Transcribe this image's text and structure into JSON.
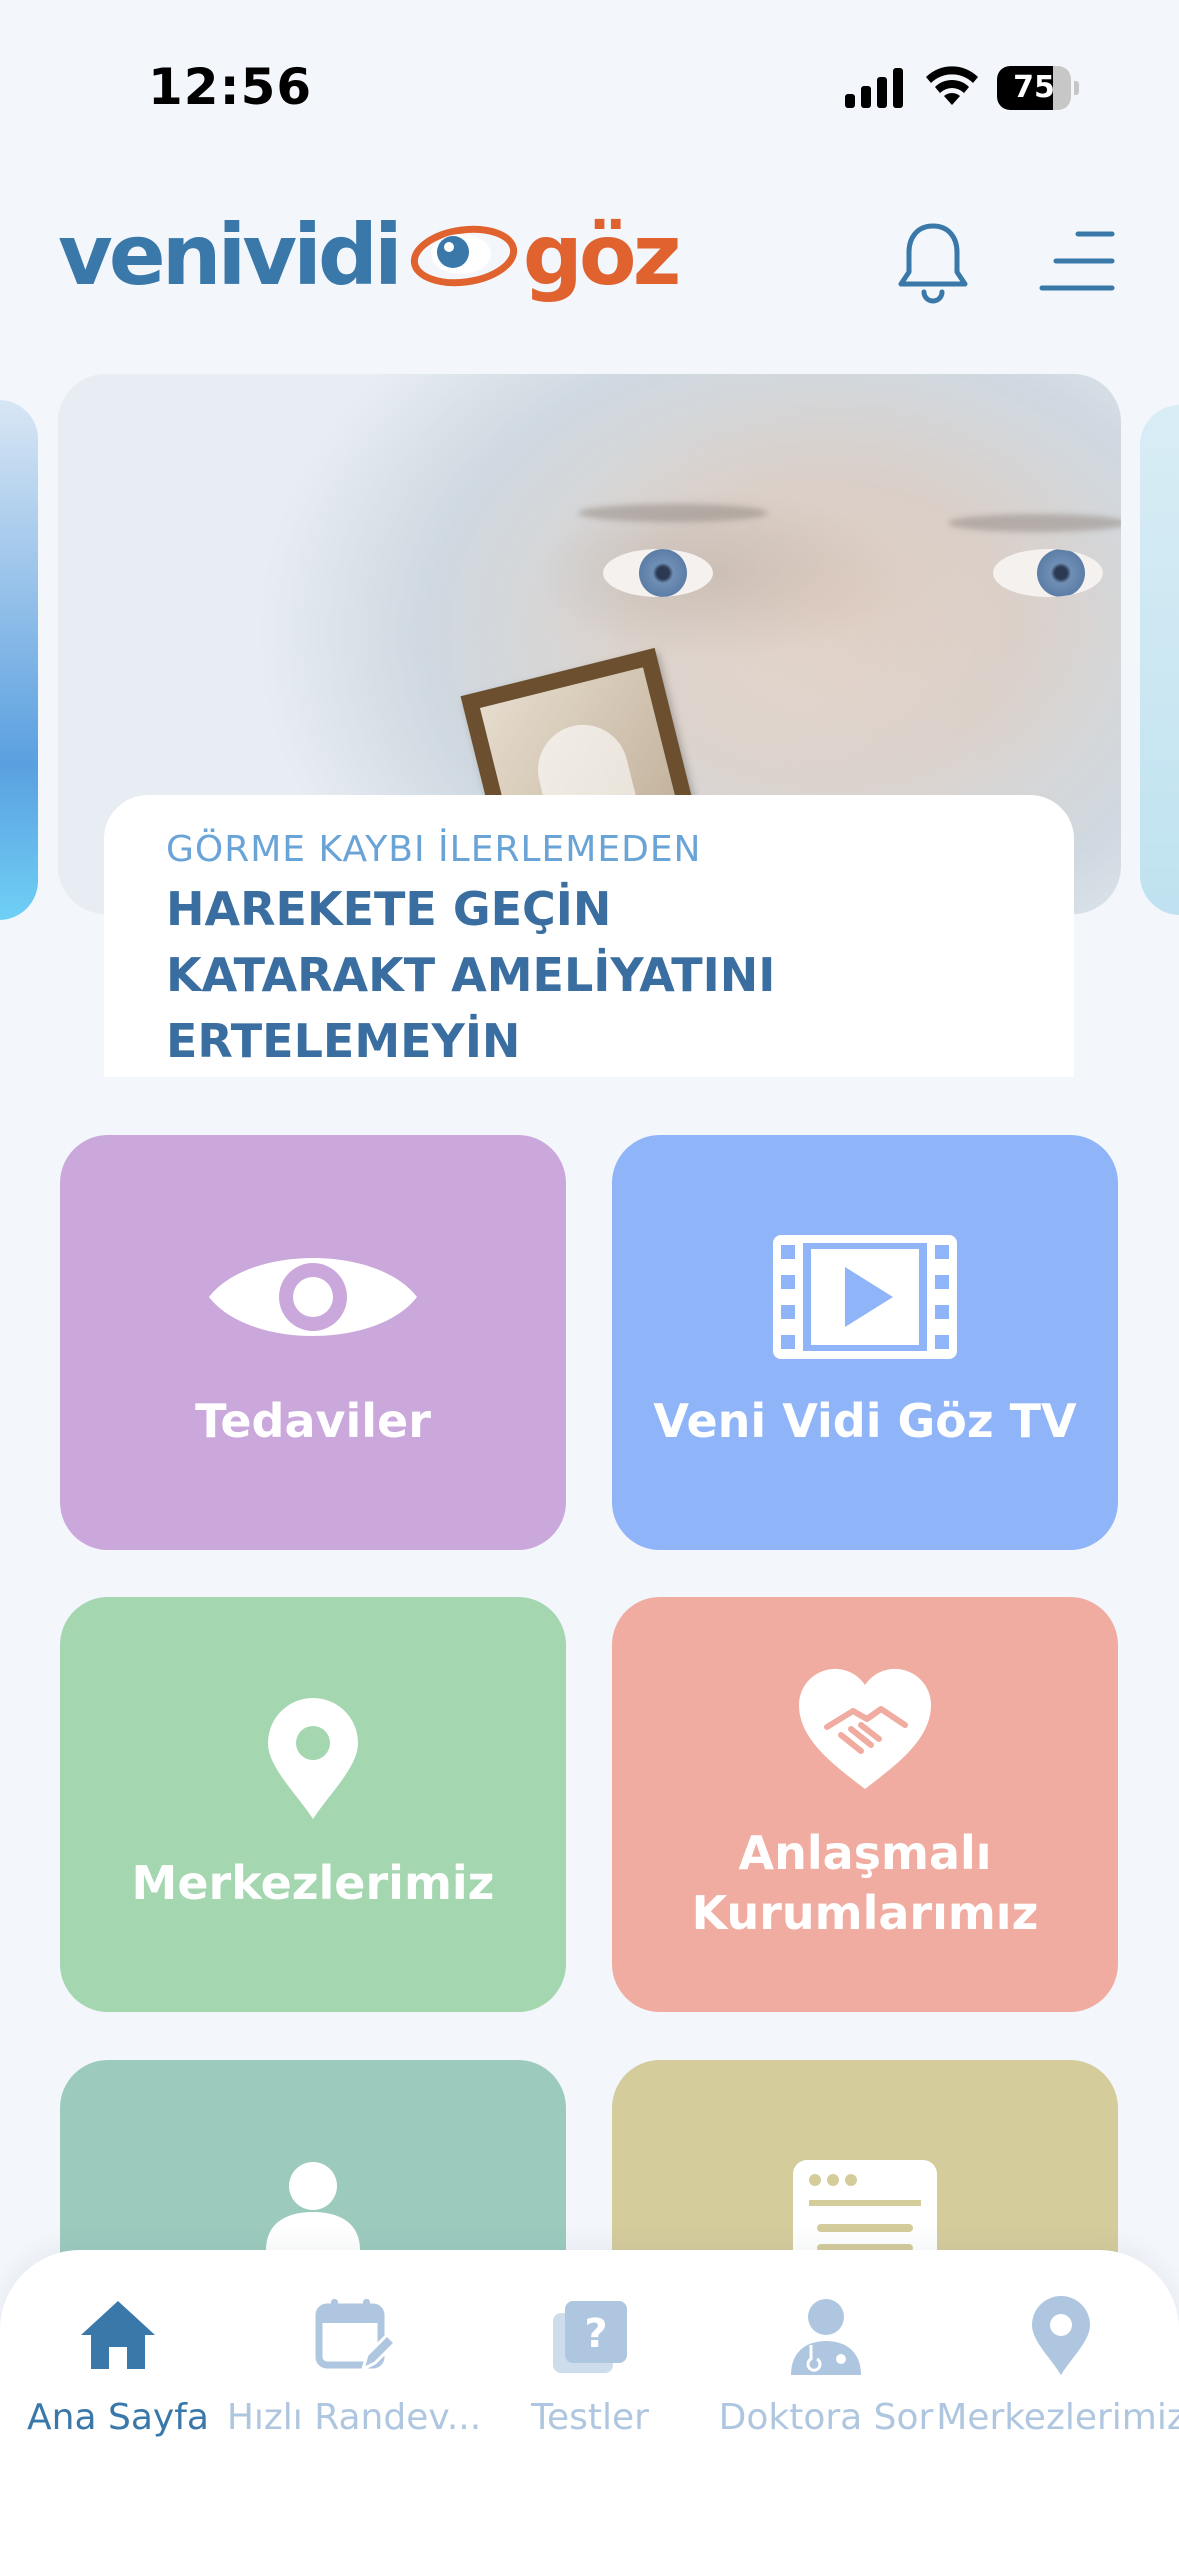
{
  "status_bar": {
    "time": "12:56",
    "battery_level": "75",
    "battery_percent": 75
  },
  "header": {
    "logo": {
      "part1": "venividi",
      "part2": "göz"
    },
    "icons": [
      "bell-icon",
      "menu-icon"
    ]
  },
  "banner": {
    "subtitle": "GÖRME KAYBI İLERLEMEDEN",
    "title_lines": [
      "HAREKETE GEÇİN",
      "KATARAKT AMELİYATINI",
      "ERTELEMEYİN"
    ]
  },
  "tiles": [
    {
      "label": "Tedaviler",
      "icon": "eye-icon",
      "color": "#cba8db"
    },
    {
      "label": "Veni Vidi Göz TV",
      "icon": "film-play-icon",
      "color": "#8fb4f8"
    },
    {
      "label": "Merkezlerimiz",
      "icon": "map-pin-icon",
      "color": "#a4d6b0"
    },
    {
      "label_lines": [
        "Anlaşmalı",
        "Kurumlarımız"
      ],
      "icon": "handshake-heart-icon",
      "color": "#f0aca1"
    },
    {
      "label": "",
      "icon": "doctor-icon",
      "color": "#9ccbbe"
    },
    {
      "label": "",
      "icon": "browser-window-icon",
      "color": "#d5cc9c"
    }
  ],
  "tabbar": {
    "items": [
      {
        "label": "Ana Sayfa",
        "icon": "home-icon",
        "active": true
      },
      {
        "label": "Hızlı Randev...",
        "icon": "calendar-edit-icon",
        "active": false
      },
      {
        "label": "Testler",
        "icon": "question-cards-icon",
        "active": false
      },
      {
        "label": "Doktora Sor",
        "icon": "doctor-icon",
        "active": false
      },
      {
        "label": "Merkezlerimiz",
        "icon": "map-pin-icon",
        "active": false
      }
    ]
  },
  "colors": {
    "brand_blue": "#3a78aa",
    "brand_orange": "#e0622f",
    "inactive_tab": "#aec6df",
    "background": "#f3f6fb"
  }
}
